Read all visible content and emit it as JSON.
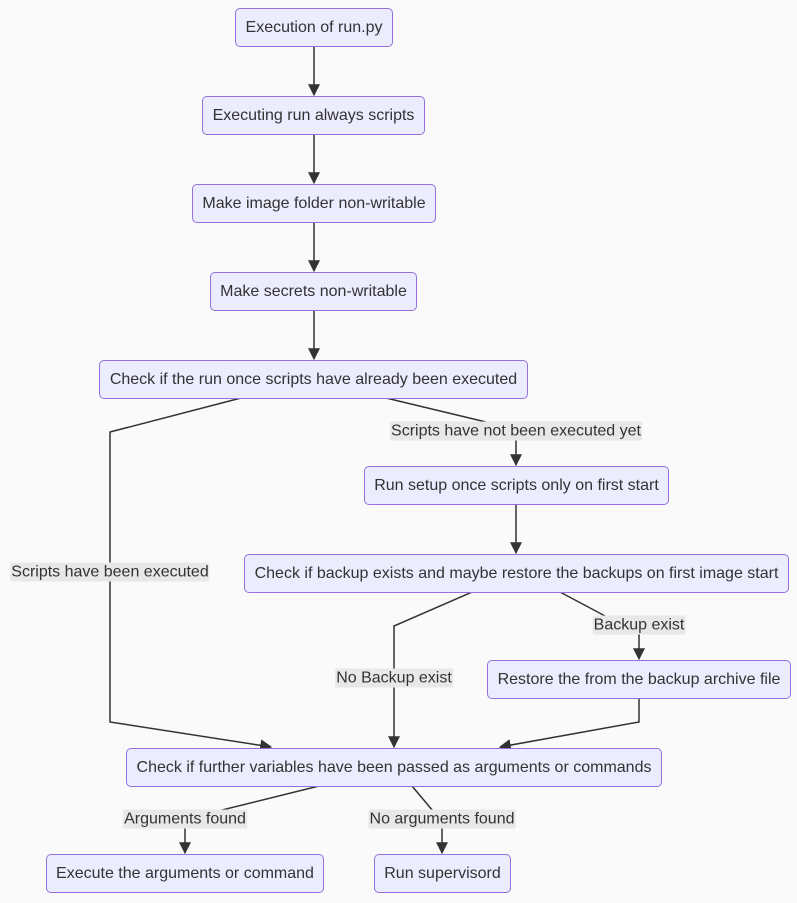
{
  "colors": {
    "node_fill": "#ececff",
    "node_border": "#9370db",
    "edge": "#333333",
    "label_bg": "#e8e8e8",
    "background": "#fafafa"
  },
  "nodes": {
    "n1": "Execution of run.py",
    "n2": "Executing run always scripts",
    "n3": "Make image folder non-writable",
    "n4": "Make secrets non-writable",
    "n5": "Check if the run once scripts have already been executed",
    "n6": "Run setup once scripts only on first start",
    "n7": "Check if backup exists and maybe restore the backups on first image start",
    "n8": "Restore the from the backup archive file",
    "n9": "Check if further variables have been passed as arguments or commands",
    "n10": "Execute the arguments or command",
    "n11": "Run supervisord"
  },
  "edges": [
    {
      "from": "n1",
      "to": "n2",
      "label": ""
    },
    {
      "from": "n2",
      "to": "n3",
      "label": ""
    },
    {
      "from": "n3",
      "to": "n4",
      "label": ""
    },
    {
      "from": "n4",
      "to": "n5",
      "label": ""
    },
    {
      "from": "n5",
      "to": "n6",
      "label": "Scripts have not been executed yet"
    },
    {
      "from": "n5",
      "to": "n9",
      "label": "Scripts have been executed"
    },
    {
      "from": "n6",
      "to": "n7",
      "label": ""
    },
    {
      "from": "n7",
      "to": "n8",
      "label": "Backup exist"
    },
    {
      "from": "n7",
      "to": "n9",
      "label": "No Backup exist"
    },
    {
      "from": "n8",
      "to": "n9",
      "label": ""
    },
    {
      "from": "n9",
      "to": "n10",
      "label": "Arguments found"
    },
    {
      "from": "n9",
      "to": "n11",
      "label": "No arguments found"
    }
  ]
}
